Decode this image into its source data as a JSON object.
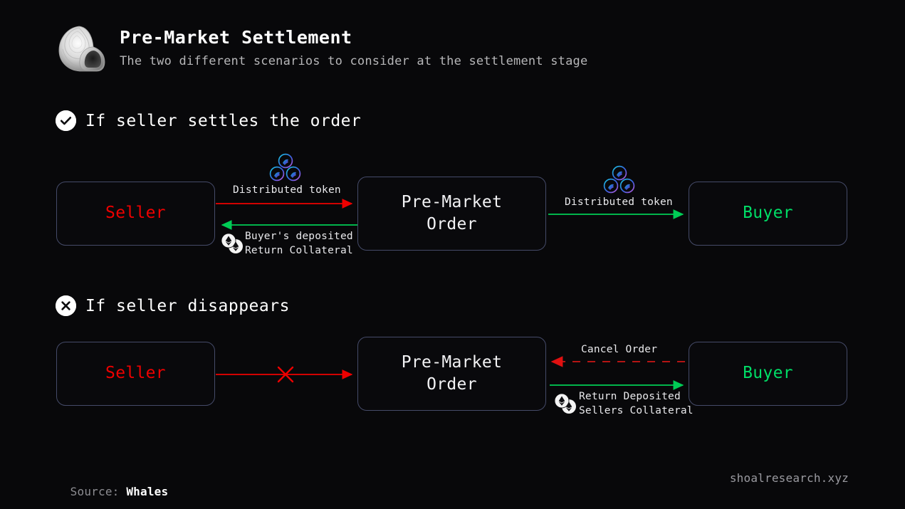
{
  "page": {
    "background": "#08080a",
    "title": "Pre-Market Settlement",
    "subtitle": "The two different scenarios to consider at the settlement stage",
    "logo_icon": "seashell-logo"
  },
  "colors": {
    "accent_red": "#ee0000",
    "accent_green": "#00dd66",
    "node_border": "#454b69",
    "dashed_red": "#b41414",
    "text_muted": "#b6b6b8",
    "badge_bg": "#ffffff"
  },
  "sections": [
    {
      "id": "seller-settles",
      "badge_icon": "check-circle-icon",
      "label": "If seller settles the order",
      "nodes": {
        "seller": "Seller",
        "order": "Pre-Market\nOrder",
        "buyer": "Buyer"
      },
      "flows": [
        {
          "id": "seller-to-order-token",
          "label": "Distributed token",
          "icon": "token-coins-icon",
          "color": "#ee0000",
          "style": "solid",
          "direction": "right"
        },
        {
          "id": "order-to-seller-collateral",
          "label": "Buyer's deposited\nReturn Collateral",
          "icon": "eth-coins-icon",
          "color": "#00cc55",
          "style": "solid",
          "direction": "left"
        },
        {
          "id": "order-to-buyer-token",
          "label": "Distributed token",
          "icon": "token-coins-icon",
          "color": "#00cc55",
          "style": "solid",
          "direction": "right"
        }
      ]
    },
    {
      "id": "seller-disappears",
      "badge_icon": "x-circle-icon",
      "label": "If seller disappears",
      "nodes": {
        "seller": "Seller",
        "order": "Pre-Market\nOrder",
        "buyer": "Buyer"
      },
      "flows": [
        {
          "id": "seller-to-order-blocked",
          "label": "",
          "icon": "x-cross-icon",
          "color": "#ee0000",
          "style": "solid-blocked",
          "direction": "right"
        },
        {
          "id": "buyer-to-order-cancel",
          "label": "Cancel Order",
          "icon": "",
          "color": "#b41414",
          "style": "dashed",
          "direction": "left"
        },
        {
          "id": "order-to-buyer-collateral",
          "label": "Return Deposited\nSellers Collateral",
          "icon": "eth-coins-icon",
          "color": "#00cc55",
          "style": "solid",
          "direction": "right"
        }
      ]
    }
  ],
  "footer": {
    "source_label": "Source: ",
    "source_value": "Whales",
    "site": "shoalresearch.xyz"
  }
}
